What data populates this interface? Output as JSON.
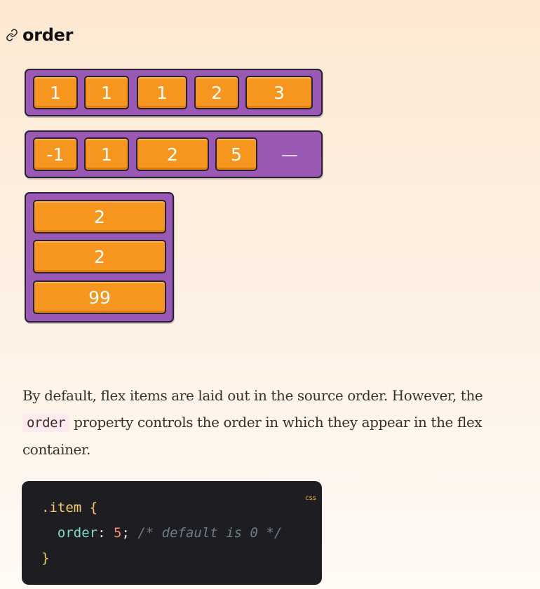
{
  "section": {
    "title": "order",
    "link_icon": "link-icon"
  },
  "demos": {
    "row1": {
      "items": [
        "1",
        "1",
        "1",
        "2",
        "3"
      ]
    },
    "row2": {
      "items": [
        "-1",
        "1",
        "2",
        "5"
      ],
      "ghost": "—"
    },
    "column": {
      "items": [
        "2",
        "2",
        "99"
      ]
    }
  },
  "description": {
    "before": "By default, flex items are laid out in the source order. However, the ",
    "code": "order",
    "after": " property controls the order in which they appear in the flex container."
  },
  "code_block": {
    "language": "css",
    "selector": ".item",
    "open_brace": "{",
    "property": "order",
    "colon": ":",
    "value": "5",
    "semicolon": ";",
    "comment": "/* default is 0 */",
    "close_brace": "}"
  },
  "colors": {
    "container": "#9a59b5",
    "item": "#f7961f",
    "outline": "#2b2230",
    "code_bg": "#1e1e22"
  }
}
